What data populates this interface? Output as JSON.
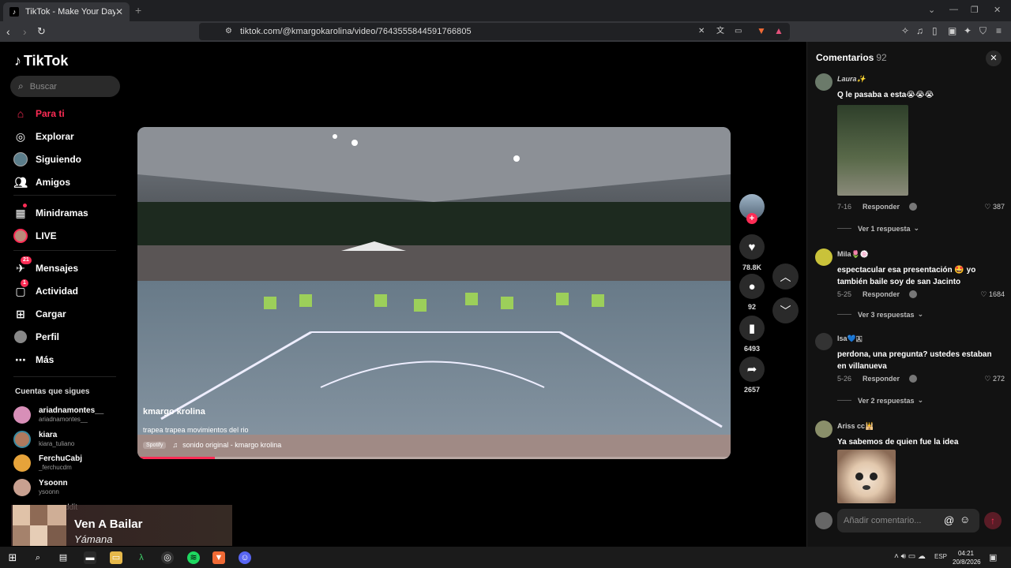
{
  "browser": {
    "tab_title": "TikTok - Make Your Day",
    "url": "tiktok.com/@kmargokarolina/video/7643555844591766805"
  },
  "sidebar": {
    "logo": "TikTok",
    "search_placeholder": "Buscar",
    "nav": [
      {
        "label": "Para ti",
        "icon": "home-icon"
      },
      {
        "label": "Explorar",
        "icon": "compass-icon"
      },
      {
        "label": "Siguiendo",
        "icon": "following-avatar-icon"
      },
      {
        "label": "Amigos",
        "icon": "friends-icon"
      },
      {
        "label": "Minidramas",
        "icon": "film-icon"
      },
      {
        "label": "LIVE",
        "icon": "live-avatar-icon"
      },
      {
        "label": "Mensajes",
        "icon": "messages-icon",
        "badge": "21"
      },
      {
        "label": "Actividad",
        "icon": "activity-icon",
        "badge": "1"
      },
      {
        "label": "Cargar",
        "icon": "upload-icon"
      },
      {
        "label": "Perfil",
        "icon": "profile-icon"
      },
      {
        "label": "Más",
        "icon": "more-icon"
      }
    ],
    "following_title": "Cuentas que sigues",
    "following": [
      {
        "name": "ariadnamontes__",
        "handle": "ariadnamontes__",
        "color": "#d88fb8"
      },
      {
        "name": "kiara",
        "handle": "kiara_tuliano",
        "color": "#b07a5e"
      },
      {
        "name": "FerchuCabj",
        "handle": "_ferchucdm",
        "color": "#e6a33a"
      },
      {
        "name": "Ysoonn",
        "handle": "ysoonn",
        "color": "#c8a090"
      }
    ],
    "peek_text": "ddit"
  },
  "miniplayer": {
    "title": "Ven A Bailar",
    "artist": "Yámana"
  },
  "video": {
    "author": "kmargo krolina",
    "description": "trapea trapea movimientos del rio",
    "badge": "Spotify",
    "sound": "sonido original - kmargo krolina",
    "progress": 0.13
  },
  "actions": {
    "likes": "78.8K",
    "comments": "92",
    "saves": "6493",
    "shares": "2657"
  },
  "comments": {
    "title": "Comentarios",
    "count": "92",
    "input_placeholder": "Añadir comentario...",
    "reply_label": "Responder",
    "items": [
      {
        "user": "Laura✨",
        "text": "Q le pasaba a esta😭😭😭",
        "date": "7-16",
        "likes": "387",
        "replies": "Ver 1 respuesta",
        "avatar": "#6b7a6a"
      },
      {
        "user": "Mila🌷🍥",
        "text": "espectacular esa presentación 🤩 yo también baile soy de san Jacinto",
        "date": "5-25",
        "likes": "1684",
        "replies": "Ver 3 respuestas",
        "avatar": "#c9c23a"
      },
      {
        "user": "Isa💙🇦",
        "text": "perdona, una pregunta? ustedes estaban en villanueva",
        "date": "5-26",
        "likes": "272",
        "replies": "Ver 2 respuestas",
        "avatar": "#333333"
      },
      {
        "user": "Ariss cc🕌",
        "text": "Ya sabemos de quien fue la idea",
        "avatar": "#8a8f6a"
      }
    ]
  },
  "taskbar": {
    "lang": "ESP",
    "time": "04:21",
    "date": "20/8/2026"
  },
  "colors": {
    "accent": "#fe2c55",
    "background": "#000000",
    "panel": "#121212"
  }
}
